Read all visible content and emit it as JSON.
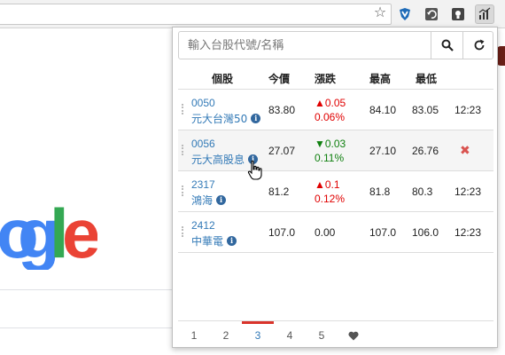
{
  "popup": {
    "search_placeholder": "輸入台股代號/名稱",
    "headers": {
      "stock": "個股",
      "price": "今價",
      "change": "漲跌",
      "high": "最高",
      "low": "最低"
    },
    "rows": [
      {
        "code": "0050",
        "name": "元大台灣50",
        "price": "83.80",
        "change": "▲0.05",
        "change_pct": "0.06%",
        "direction": "up",
        "high": "84.10",
        "low": "83.05",
        "time": "12:23"
      },
      {
        "code": "0056",
        "name": "元大高股息",
        "price": "27.07",
        "change": "▼0.03",
        "change_pct": "0.11%",
        "direction": "down",
        "high": "27.10",
        "low": "26.76",
        "time": "",
        "remove_icon": "✖"
      },
      {
        "code": "2317",
        "name": "鴻海",
        "price": "81.2",
        "change": "▲0.1",
        "change_pct": "0.12%",
        "direction": "up",
        "high": "81.8",
        "low": "80.3",
        "time": "12:23"
      },
      {
        "code": "2412",
        "name": "中華電",
        "price": "107.0",
        "change": "0.00",
        "change_pct": "",
        "direction": "neutral",
        "high": "107.0",
        "low": "106.0",
        "time": "12:23"
      }
    ],
    "pages": [
      "1",
      "2",
      "3",
      "4",
      "5"
    ],
    "active_page": "3"
  },
  "toolbar": {
    "star_icon": "☆"
  },
  "colors": {
    "up": "#e00000",
    "down": "#108010",
    "link": "#337ab7",
    "active_page_bar": "#d9342b"
  }
}
